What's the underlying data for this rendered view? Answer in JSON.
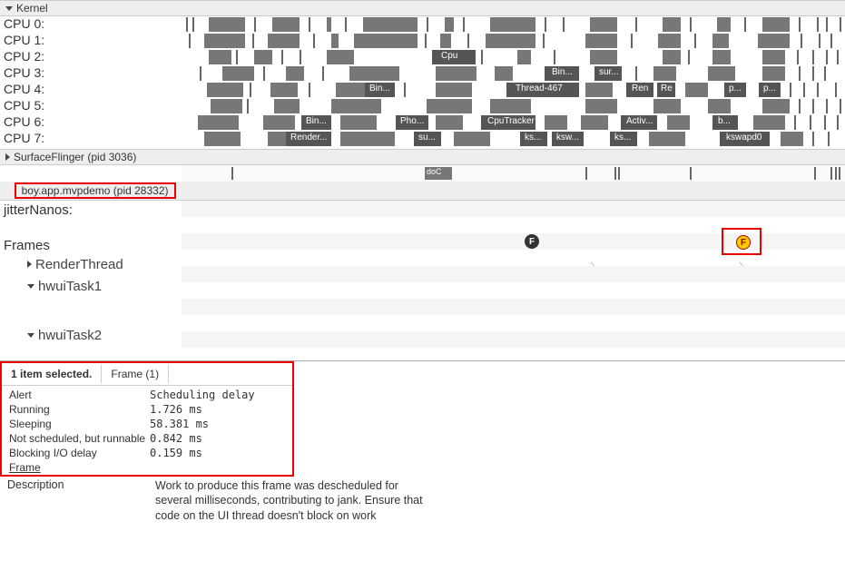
{
  "kernel": {
    "title": "Kernel",
    "cpus": [
      "CPU 0:",
      "CPU 1:",
      "CPU 2:",
      "CPU 3:",
      "CPU 4:",
      "CPU 5:",
      "CPU 6:",
      "CPU 7:"
    ],
    "bar_labels": {
      "cpu": "Cpu",
      "bin": "Bin...",
      "sur": "sur...",
      "thread": "Thread-467",
      "ren": "Ren",
      "re": "Re",
      "p1": "p...",
      "p2": "p...",
      "pho": "Pho...",
      "cputracker": "CpuTracker",
      "activ": "Activ...",
      "b": "b...",
      "render": "Render...",
      "su": "su...",
      "ks1": "ks...",
      "ksw": "ksw...",
      "ks2": "ks...",
      "kswapd0": "kswapd0"
    }
  },
  "surfaceflinger": {
    "title": "SurfaceFlinger (pid 3036)",
    "doc": "doC"
  },
  "process": {
    "title": "boy.app.mvpdemo (pid 28332)",
    "jitter": "jitterNanos:",
    "frames": "Frames",
    "threads": [
      "RenderThread",
      "hwuiTask1",
      "hwuiTask2"
    ],
    "marker_f": "F"
  },
  "panel": {
    "selected": "1 item selected.",
    "tab": "Frame (1)",
    "rows": [
      {
        "key": "Alert",
        "val": "Scheduling delay"
      },
      {
        "key": "Running",
        "val": "1.726 ms"
      },
      {
        "key": "Sleeping",
        "val": "58.381 ms"
      },
      {
        "key": "Not scheduled, but runnable",
        "val": "0.842 ms"
      },
      {
        "key": "Blocking I/O delay",
        "val": "0.159 ms"
      },
      {
        "key": "Frame",
        "val": ""
      }
    ],
    "desc_key": "Description",
    "desc_val": "Work to produce this frame was descheduled for several milliseconds, contributing to jank. Ensure that code on the UI thread doesn't block on work"
  }
}
